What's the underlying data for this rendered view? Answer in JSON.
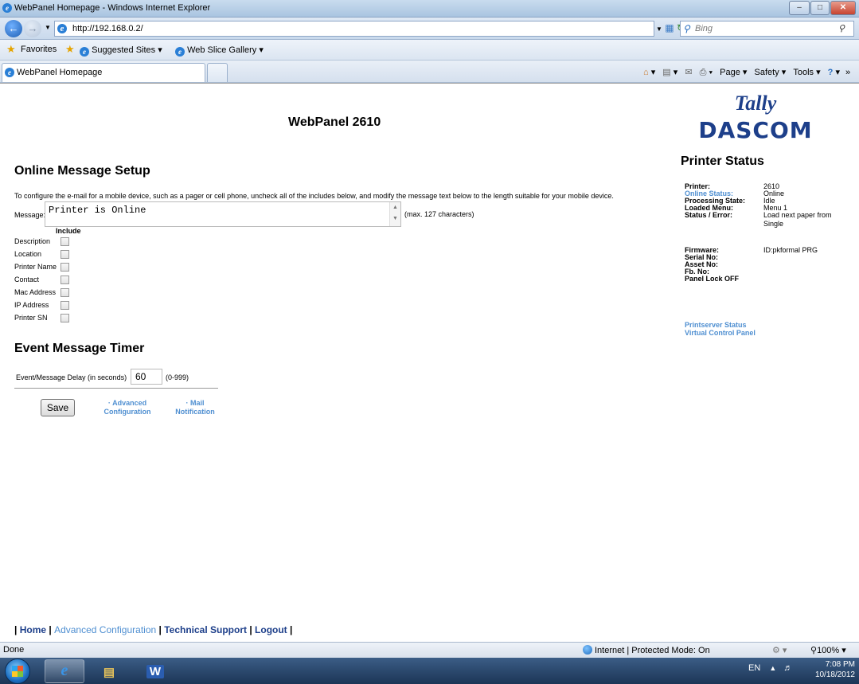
{
  "window": {
    "title": "WebPanel Homepage - Windows Internet Explorer",
    "address": "http://192.168.0.2/",
    "search_placeholder": "Bing",
    "tab_title": "WebPanel Homepage",
    "favorites": {
      "label": "Favorites",
      "suggested": "Suggested Sites",
      "slice": "Web Slice Gallery"
    },
    "commands": {
      "page": "Page",
      "safety": "Safety",
      "tools": "Tools"
    }
  },
  "page": {
    "title": "WebPanel 2610",
    "logo": {
      "line1": "Tally",
      "line2": "DASCOM"
    },
    "online_setup": {
      "heading": "Online Message Setup",
      "description": "To configure the e-mail for a mobile device, such as a pager or cell phone, uncheck all of the includes below, and modify the message text below to the length suitable for your mobile device.",
      "message_label": "Message:",
      "message_value": "Printer is Online",
      "max_note": "(max. 127 characters)",
      "include_heading": "Include",
      "includes": [
        {
          "label": "Description",
          "checked": false
        },
        {
          "label": "Location",
          "checked": false
        },
        {
          "label": "Printer Name",
          "checked": false
        },
        {
          "label": "Contact",
          "checked": false
        },
        {
          "label": "Mac Address",
          "checked": false
        },
        {
          "label": "IP Address",
          "checked": false
        },
        {
          "label": "Printer SN",
          "checked": false
        }
      ]
    },
    "event_timer": {
      "heading": "Event Message Timer",
      "delay_label": "Event/Message Delay (in seconds)",
      "delay_value": "60",
      "delay_range": "(0-999)"
    },
    "actions": {
      "save": "Save",
      "advanced_1": "Advanced",
      "advanced_2": "Configuration",
      "mail_1": "Mail",
      "mail_2": "Notification"
    },
    "status": {
      "heading": "Printer Status",
      "rows": [
        {
          "key": "Printer:",
          "value": "2610"
        },
        {
          "key": "Online Status:",
          "value": "Online"
        },
        {
          "key": "Processing State:",
          "value": "Idle"
        },
        {
          "key": "Loaded Menu:",
          "value": "Menu 1"
        },
        {
          "key": "Status / Error:",
          "value": "Load next paper from Single"
        },
        {
          "key": "Firmware:",
          "value": "ID:pkformal PRG"
        },
        {
          "key": "Serial No:",
          "value": ""
        },
        {
          "key": "Asset No:",
          "value": ""
        },
        {
          "key": "Fb. No:",
          "value": ""
        },
        {
          "key": "Panel Lock OFF",
          "value": ""
        }
      ],
      "links": [
        "Printserver Status",
        "Virtual Control Panel"
      ]
    },
    "footer": {
      "home": "Home",
      "advanced": "Advanced Configuration",
      "support": "Technical Support",
      "logout": "Logout"
    }
  },
  "statusbar": {
    "left": "Done",
    "zone": "Internet | Protected Mode: On",
    "zoom": "100%"
  },
  "taskbar": {
    "lang": "EN",
    "time": "7:08 PM",
    "date": "10/18/2012"
  }
}
